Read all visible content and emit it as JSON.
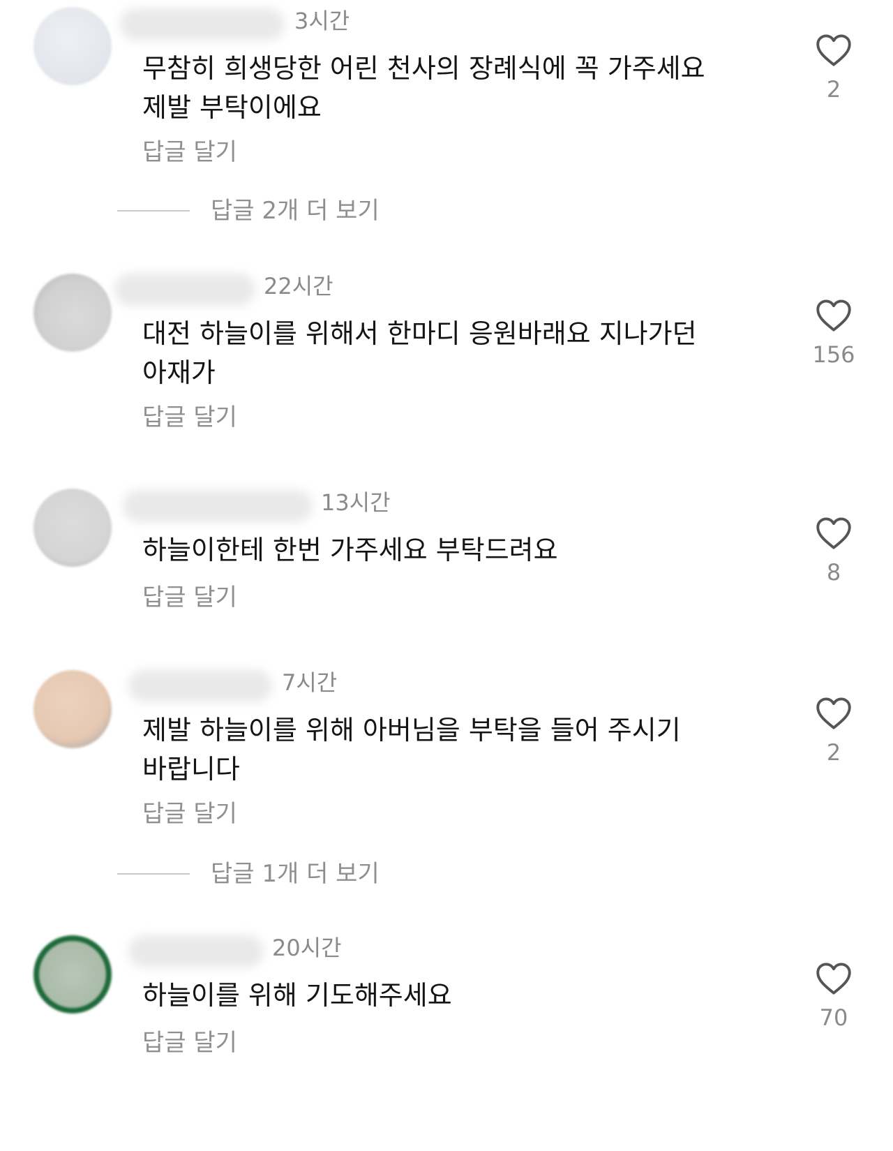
{
  "comments": [
    {
      "time": "3시간",
      "text": "무참히 희생당한 어린 천사의 장례식에 꼭 가주세요\n제발 부탁이에요",
      "reply_label": "답글 달기",
      "likes": "2",
      "avatar_color": "#e6e8ef",
      "more_replies": "답글 2개 더 보기"
    },
    {
      "time": "22시간",
      "text": "대전 하늘이를 위해서 한마디 응원바래요 지나가던\n아재가",
      "reply_label": "답글 달기",
      "likes": "156",
      "avatar_color": "#d4d4d4"
    },
    {
      "time": "13시간",
      "text": "하늘이한테 한번 가주세요 부탁드려요",
      "reply_label": "답글 달기",
      "likes": "8",
      "avatar_color": "#d8d8d8"
    },
    {
      "time": "7시간",
      "text": "제발 하늘이를 위해 아버님을 부탁을 들어 주시기\n바랍니다",
      "reply_label": "답글 달기",
      "likes": "2",
      "avatar_color": "#e7c9b3",
      "more_replies": "답글 1개 더 보기"
    },
    {
      "time": "20시간",
      "text": "하늘이를 위해 기도해주세요",
      "reply_label": "답글 달기",
      "likes": "70",
      "avatar_color": "#aebfae",
      "avatar_ring": "#1e6b3a"
    }
  ]
}
